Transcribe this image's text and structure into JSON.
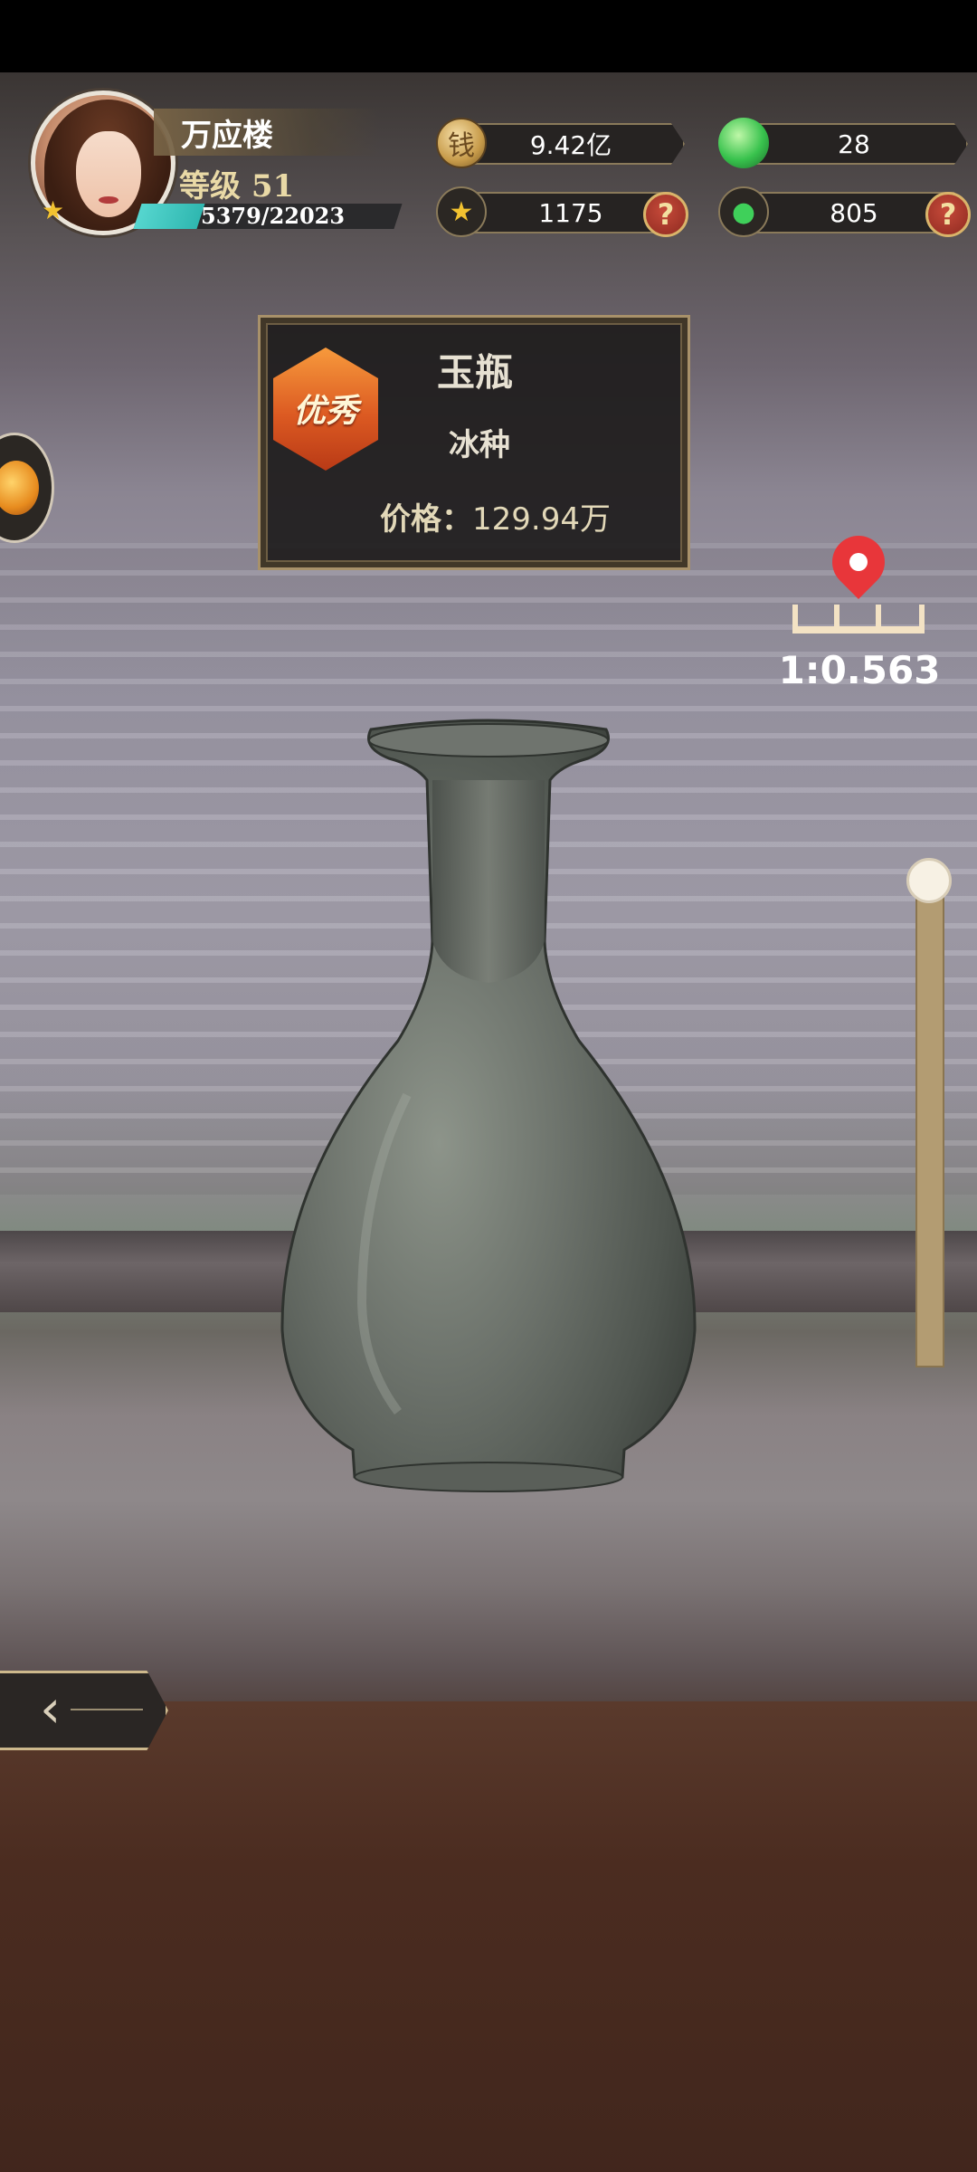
{
  "player": {
    "name": "万应楼",
    "level_label": "等级 51",
    "exp_text": "5379/22023",
    "exp_progress": 0.244
  },
  "resources": {
    "coins": "9.42亿",
    "gems": "28",
    "stars": "1175",
    "stamina": "805"
  },
  "item": {
    "rank": "优秀",
    "name": "玉瓶",
    "quality": "冰种",
    "price_label": "价格：",
    "price_value": "129.94万"
  },
  "scale": {
    "ratio_text": "1:0.563"
  },
  "zoom_slider": {
    "level": 1.0
  },
  "icons": [
    "coin-icon",
    "gem-icon",
    "star-icon",
    "bomb-icon",
    "help-icon",
    "map-pin-icon",
    "ruler-icon",
    "back-arrow-icon"
  ],
  "colors": {
    "accent_gold": "#a8916a",
    "help_red": "#8e2a20",
    "exp_teal": "#56d6cf",
    "rank_orange": "#dc5a22",
    "pin_red": "#e8363a"
  }
}
